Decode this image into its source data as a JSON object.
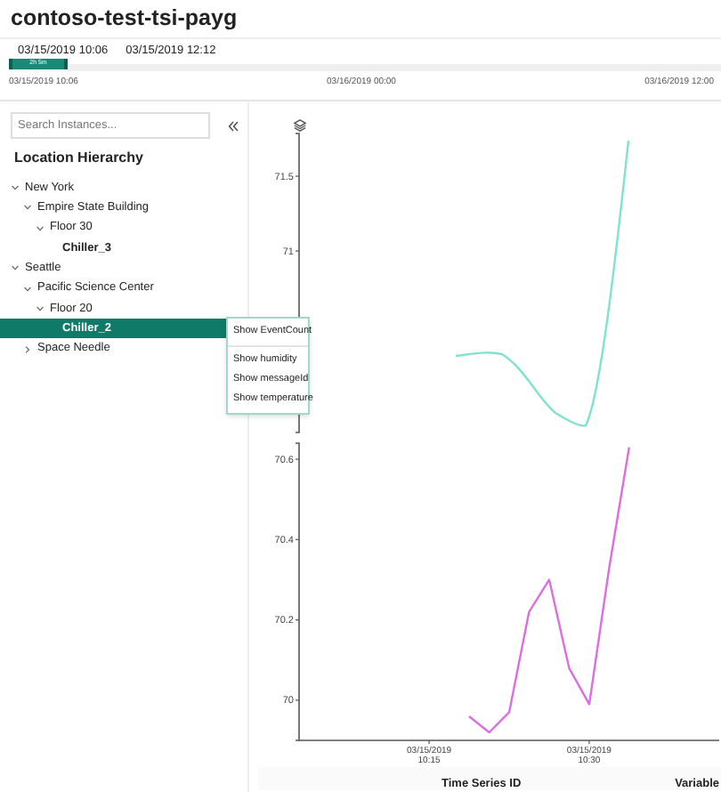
{
  "title": "contoso-test-tsi-payg",
  "time_range": {
    "start": "03/15/2019 10:06",
    "end": "03/15/2019 12:12",
    "brush_label": "2h 5m",
    "ticks": [
      "03/15/2019 10:06",
      "03/16/2019 00:00",
      "03/16/2019 12:00"
    ]
  },
  "search": {
    "placeholder": "Search Instances..."
  },
  "hierarchy": {
    "title": "Location Hierarchy",
    "items": [
      {
        "label": "New York",
        "kind": "node",
        "expanded": true,
        "selected": false,
        "children": [
          {
            "label": "Empire State Building",
            "kind": "node",
            "expanded": true,
            "selected": false,
            "children": [
              {
                "label": "Floor 30",
                "kind": "node",
                "expanded": true,
                "selected": false,
                "children": [
                  {
                    "label": "Chiller_3",
                    "kind": "instance",
                    "selected": false
                  }
                ]
              }
            ]
          }
        ]
      },
      {
        "label": "Seattle",
        "kind": "node",
        "expanded": true,
        "selected": false,
        "children": [
          {
            "label": "Pacific Science Center",
            "kind": "node",
            "expanded": true,
            "selected": false,
            "children": [
              {
                "label": "Floor 20",
                "kind": "node",
                "expanded": true,
                "selected": false,
                "children": [
                  {
                    "label": "Chiller_2",
                    "kind": "instance",
                    "selected": true
                  }
                ]
              }
            ]
          },
          {
            "label": "Space Needle",
            "kind": "node",
            "expanded": false,
            "selected": false
          }
        ]
      }
    ]
  },
  "context_menu": {
    "sections": [
      {
        "items": [
          "Show EventCount"
        ]
      },
      {
        "items": [
          "Show humidity",
          "Show messageId",
          "Show temperature"
        ]
      }
    ]
  },
  "charts": [
    {
      "kind": "picture",
      "y_labels": [
        "71.5",
        "71"
      ]
    },
    {
      "chart_data": {
        "type": "line",
        "categories": [
          null,
          null,
          null,
          null,
          null,
          null,
          "03/15/2019 10:15",
          null,
          null,
          null,
          null,
          null,
          null,
          null,
          "03/15/2019 10:30",
          null,
          null,
          null,
          null,
          null,
          null
        ],
        "series": [
          {
            "color": "#dc6ee0",
            "values": [
              null,
              null,
              null,
              null,
              null,
              null,
              null,
              null,
              69.96,
              69.92,
              69.97,
              70.22,
              70.3,
              70.08,
              69.99,
              70.33,
              70.63,
              null,
              null,
              null,
              null
            ]
          }
        ],
        "ylim": [
          69.9,
          70.64
        ],
        "yticks": [
          70,
          70.2,
          70.4,
          70.6
        ]
      }
    }
  ],
  "table": {
    "columns": [
      "Time Series ID",
      "Variable"
    ]
  }
}
